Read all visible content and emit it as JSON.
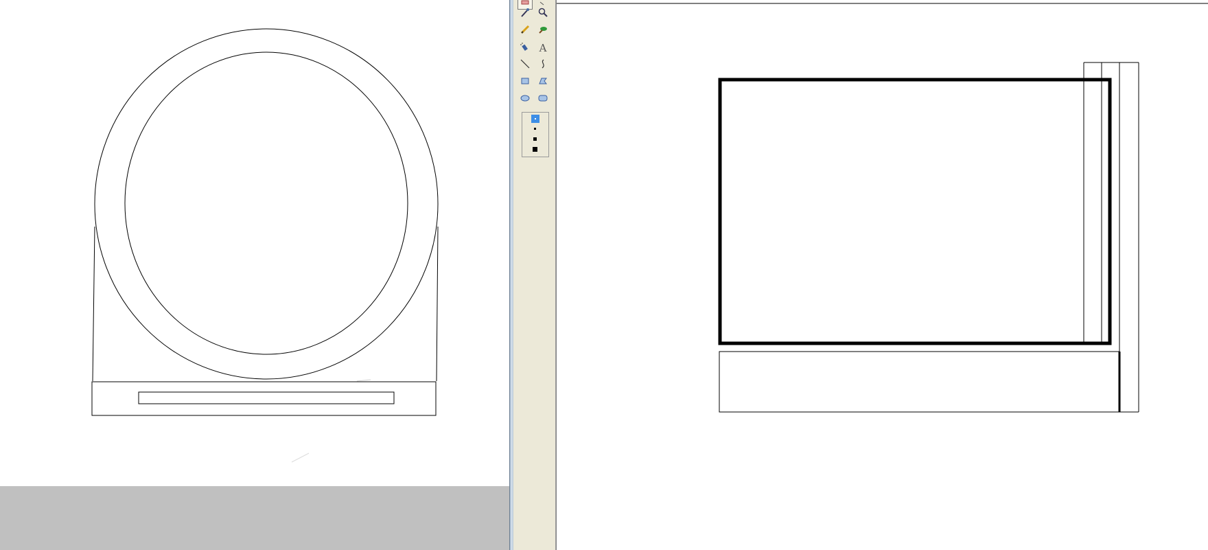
{
  "left_window": {
    "canvas_color": "#ffffff",
    "workspace_color": "#c0c0c0",
    "drawing": "ring-on-stand"
  },
  "right_window": {
    "canvas_color": "#ffffff",
    "toolbox_color": "#ece9d8",
    "drawing": "framed-rectangles"
  },
  "toolbox": {
    "tools": [
      {
        "name": "eraser-tool",
        "icon": "eraser-icon"
      },
      {
        "name": "fill-tool",
        "icon": "fill-icon"
      },
      {
        "name": "color-picker-tool",
        "icon": "eyedropper-icon"
      },
      {
        "name": "magnifier-tool",
        "icon": "magnifier-icon"
      },
      {
        "name": "pencil-tool",
        "icon": "pencil-icon"
      },
      {
        "name": "brush-tool",
        "icon": "brush-icon"
      },
      {
        "name": "airbrush-tool",
        "icon": "airbrush-icon"
      },
      {
        "name": "text-tool",
        "icon": "text-icon",
        "glyph": "A"
      },
      {
        "name": "line-tool",
        "icon": "line-icon"
      },
      {
        "name": "curve-tool",
        "icon": "curve-icon"
      },
      {
        "name": "rectangle-tool",
        "icon": "rectangle-icon"
      },
      {
        "name": "polygon-tool",
        "icon": "polygon-icon"
      },
      {
        "name": "ellipse-tool",
        "icon": "ellipse-icon"
      },
      {
        "name": "rounded-rectangle-tool",
        "icon": "rounded-rectangle-icon"
      }
    ],
    "line_sizes": [
      "1",
      "2",
      "3",
      "4"
    ],
    "selected_line_size": "1",
    "accent_color": "#3d8ee6"
  }
}
